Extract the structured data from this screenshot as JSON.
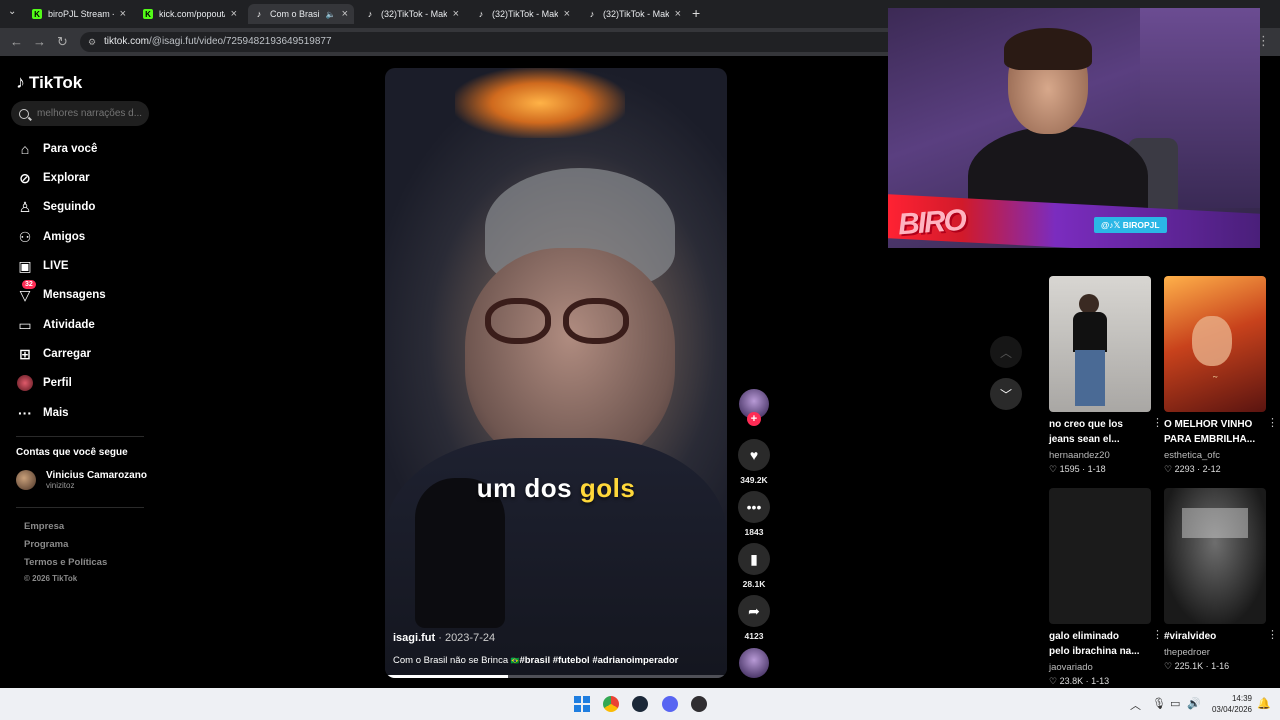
{
  "browser": {
    "tabs": [
      {
        "title": "biroPJL Stream - V",
        "favicon": "kick",
        "active": false
      },
      {
        "title": "kick.com/popout/",
        "favicon": "kick",
        "active": false
      },
      {
        "title": "Com o Brasil n",
        "favicon": "tiktok",
        "active": true
      },
      {
        "title": "(32)TikTok - Make",
        "favicon": "tiktok",
        "active": false
      },
      {
        "title": "(32)TikTok - Make",
        "favicon": "tiktok",
        "active": false
      },
      {
        "title": "(32)TikTok - Make",
        "favicon": "tiktok",
        "active": false
      }
    ],
    "url_host": "tiktok.com",
    "url_path": "/@isagi.fut/video/7259482193649519877"
  },
  "sidebar": {
    "logo": "TikTok",
    "search_placeholder": "melhores narrações d...",
    "nav": [
      {
        "label": "Para você",
        "icon": "home-icon"
      },
      {
        "label": "Explorar",
        "icon": "compass-icon"
      },
      {
        "label": "Seguindo",
        "icon": "following-icon"
      },
      {
        "label": "Amigos",
        "icon": "friends-icon"
      },
      {
        "label": "LIVE",
        "icon": "live-icon"
      },
      {
        "label": "Mensagens",
        "icon": "messages-icon",
        "badge": "32"
      },
      {
        "label": "Atividade",
        "icon": "activity-icon"
      },
      {
        "label": "Carregar",
        "icon": "upload-icon"
      },
      {
        "label": "Perfil",
        "icon": "profile-avatar-icon"
      },
      {
        "label": "Mais",
        "icon": "more-icon"
      }
    ],
    "following_title": "Contas que você segue",
    "following": [
      {
        "name": "Vinicius Camarozano",
        "handle": "vinizitoz"
      }
    ],
    "footer": [
      "Empresa",
      "Programa",
      "Termos e Políticas"
    ],
    "copyright": "© 2026 TikTok"
  },
  "video": {
    "caption_prefix": "um dos ",
    "caption_highlight": "gols",
    "author": "isagi.fut",
    "date": " · 2023-7-24",
    "description_text": "Com o Brasil não se Brinca ",
    "flag": "🇧🇷",
    "hashtags": "#brasil #futebol #adrianoimperador",
    "progress": 0.36
  },
  "actions": {
    "likes": "349.2K",
    "comments": "1843",
    "saves": "28.1K",
    "shares": "4123"
  },
  "stream_overlay": {
    "brand": "BIRO",
    "social_handle": "BIROPJL",
    "social_icons": "@♪𝕏"
  },
  "recommended": [
    {
      "title": "no creo que los jeans sean el...",
      "author": "hernaandez20",
      "likes": "1595",
      "date": "1-18"
    },
    {
      "title": "O MELHOR VINHO PARA EMBRILHA...",
      "author": "esthetica_ofc",
      "likes": "2293",
      "date": "2-12"
    },
    {
      "title": "galo eliminado pelo ibrachina na...",
      "author": "jaovariado",
      "likes": "23.8K",
      "date": "1-13"
    },
    {
      "title": "#viralvideo",
      "author": "thepedroer",
      "likes": "225.1K",
      "date": "1-16"
    }
  ],
  "taskbar": {
    "time": "14:39",
    "date": "03/04/2026"
  },
  "colors": {
    "tiktok_red": "#fe2c55",
    "caption_highlight": "#ffd83a",
    "kick_green": "#53fc18"
  }
}
